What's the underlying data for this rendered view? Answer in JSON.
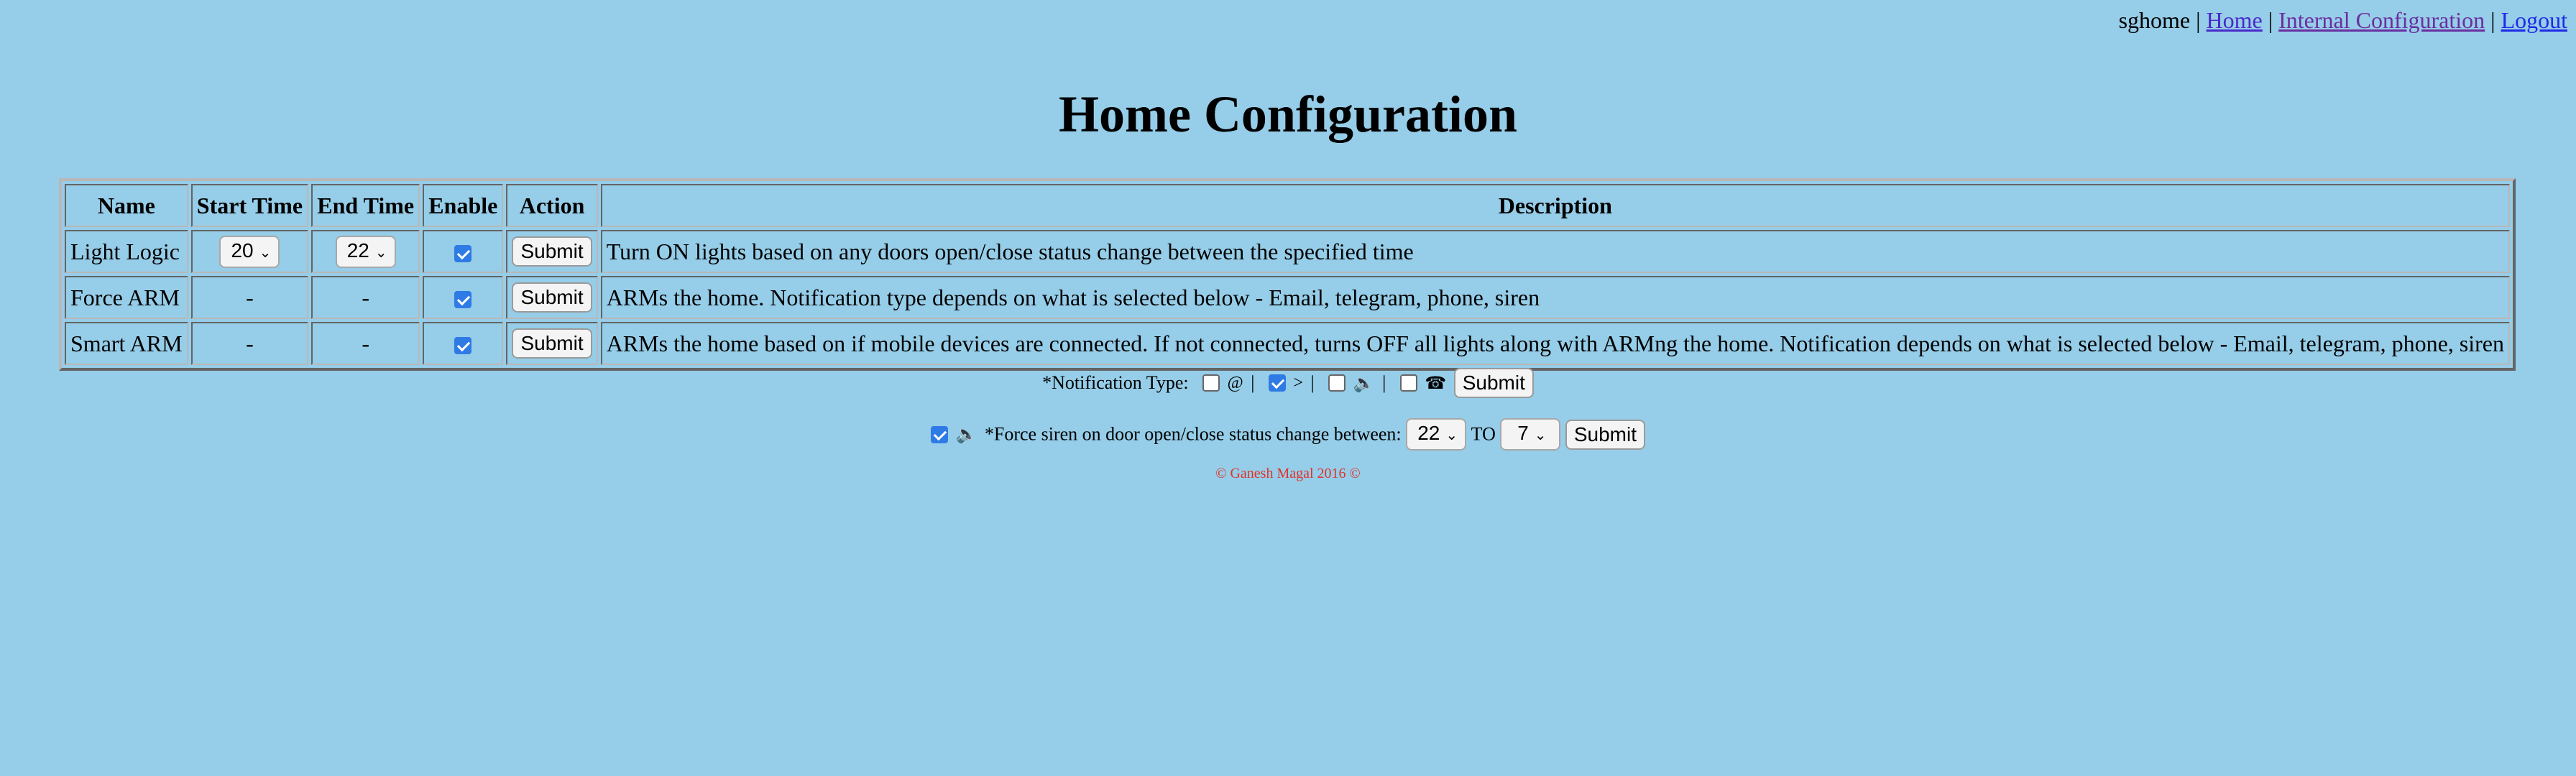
{
  "nav": {
    "user": "sghome",
    "sep": "|",
    "links": [
      "Home",
      "Internal Configuration",
      "Logout"
    ]
  },
  "page": {
    "title": "Home Configuration"
  },
  "table": {
    "headers": [
      "Name",
      "Start Time",
      "End Time",
      "Enable",
      "Action",
      "Description"
    ],
    "rows": [
      {
        "name": "Light Logic",
        "start": "20",
        "end": "22",
        "enabled": true,
        "action": "Submit",
        "description": "Turn ON lights based on any doors open/close status change between the specified time"
      },
      {
        "name": "Force ARM",
        "start": "-",
        "end": "-",
        "enabled": true,
        "action": "Submit",
        "description": "ARMs the home. Notification type depends on what is selected below - Email, telegram, phone, siren"
      },
      {
        "name": "Smart ARM",
        "start": "-",
        "end": "-",
        "enabled": true,
        "action": "Submit",
        "description": "ARMs the home based on if mobile devices are connected. If not connected, turns OFF all lights along with ARMng the home. Notification depends on what is selected below - Email, telegram, phone, siren"
      }
    ]
  },
  "notification": {
    "label": "*Notification Type:",
    "options": [
      {
        "symbol": "@",
        "icon": "email-icon",
        "checked": false
      },
      {
        "symbol": ">",
        "icon": "telegram-icon",
        "checked": true
      },
      {
        "symbol": "🔈",
        "icon": "siren-icon",
        "checked": false
      },
      {
        "symbol": "☎",
        "icon": "phone-icon",
        "checked": false
      }
    ],
    "sep": "|",
    "submit": "Submit"
  },
  "force_siren": {
    "checked": true,
    "icon_symbol": "🔈",
    "label": "*Force siren on door open/close status change between:",
    "from": "22",
    "to_label": "TO",
    "to": "7",
    "submit": "Submit"
  },
  "footer": {
    "text": "© Ganesh Magal 2016 ©"
  }
}
